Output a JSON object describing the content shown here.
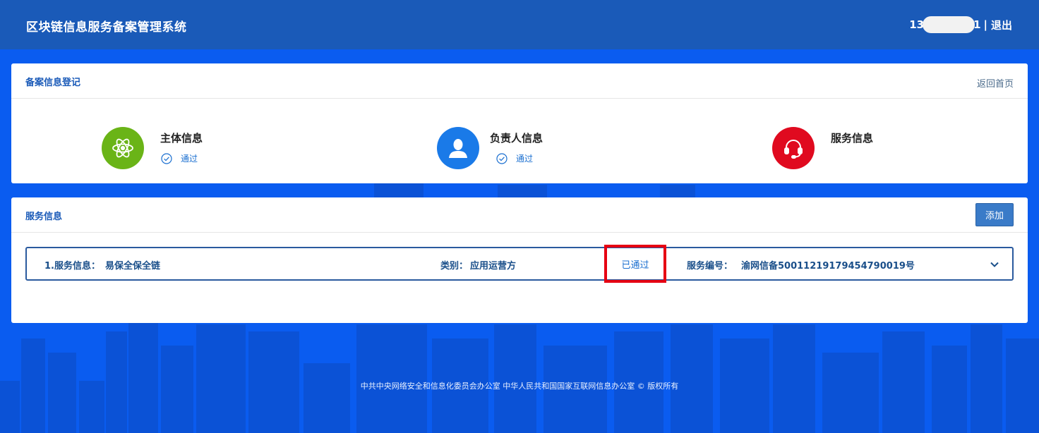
{
  "header": {
    "title": "区块链信息服务备案管理系统",
    "user_prefix": "13",
    "user_suffix": "1",
    "separator": "|",
    "logout_label": "退出"
  },
  "registration": {
    "title": "备案信息登记",
    "back_home_label": "返回首页",
    "steps": [
      {
        "label": "主体信息",
        "status": "通过",
        "icon": "atom-icon",
        "color": "#6ab417"
      },
      {
        "label": "负责人信息",
        "status": "通过",
        "icon": "user-icon",
        "color": "#1a7ae8"
      },
      {
        "label": "服务信息",
        "status": "",
        "icon": "headset-icon",
        "color": "#e00a1f"
      }
    ]
  },
  "services": {
    "title": "服务信息",
    "add_label": "添加",
    "items": [
      {
        "name_label": "1.服务信息：",
        "name": "易保全保全链",
        "category_label": "类别：",
        "category": "应用运营方",
        "status": "已通过",
        "number_label": "服务编号：",
        "number": "渝网信备50011219179454790019号"
      }
    ]
  },
  "footer": {
    "text": "中共中央网络安全和信息化委员会办公室   中华人民共和国国家互联网信息办公室 © 版权所有"
  },
  "colors": {
    "topbar": "#1a5ab8",
    "background": "#0a5cf0",
    "highlight_box": "#e60012"
  }
}
